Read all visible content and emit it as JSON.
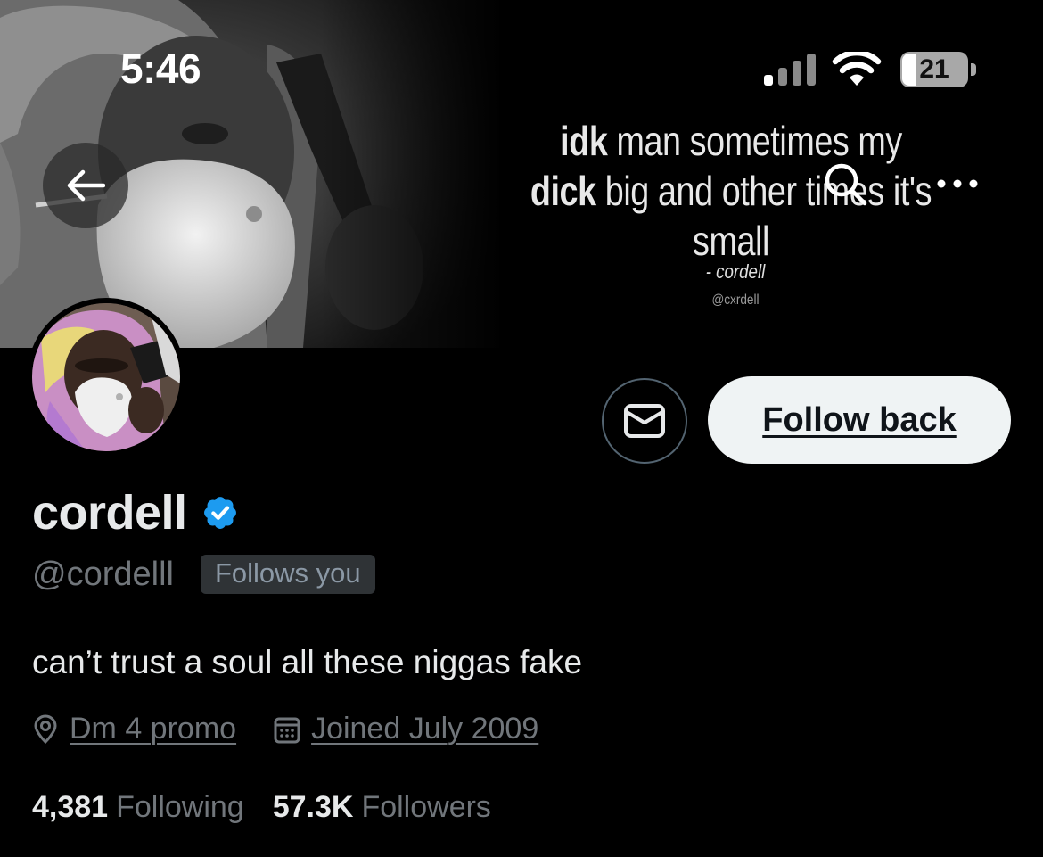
{
  "status_bar": {
    "time": "5:46",
    "battery_level": "21",
    "battery_fraction": 0.21
  },
  "banner": {
    "quote_parts": [
      {
        "text": "idk",
        "bold": true
      },
      {
        "text": " man sometimes my ",
        "bold": false
      },
      {
        "text": "dick",
        "bold": true
      },
      {
        "text": " big and other times it's small",
        "bold": false
      }
    ],
    "author": "- cordell",
    "handle": "@cxrdell"
  },
  "nav": {
    "back_icon": "arrow-left-icon",
    "search_icon": "search-icon",
    "more_icon": "more-horizontal-icon"
  },
  "actions": {
    "message_icon": "envelope-icon",
    "follow_label": "Follow back"
  },
  "profile": {
    "display_name": "cordell",
    "verified": true,
    "handle": "@cordelll",
    "follows_you": "Follows you",
    "bio": "can’t trust a soul all these niggas fake",
    "location": "Dm 4 promo",
    "joined": "Joined July 2009",
    "following_count": "4,381",
    "following_label": "Following",
    "followers_count": "57.3K",
    "followers_label": "Followers"
  },
  "colors": {
    "background": "#000000",
    "primary_text": "#e7e9ea",
    "secondary_text": "#71767b",
    "verified_blue": "#1d9bf0",
    "follow_button_bg": "#eff3f4"
  }
}
